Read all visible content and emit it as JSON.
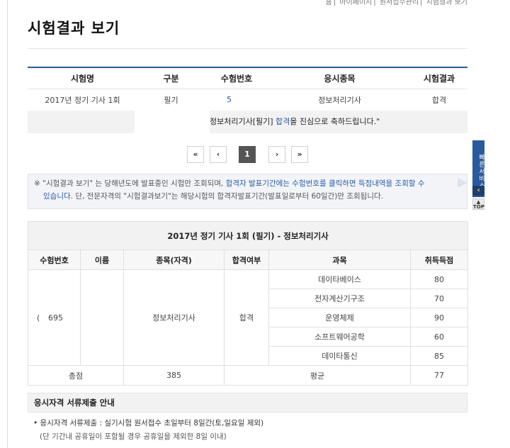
{
  "top_nav": [
    "홈",
    "마이페이지",
    "원서접수관리",
    "시험결과 보기"
  ],
  "page_title": "시험결과 보기",
  "result_table": {
    "headers": [
      "시험명",
      "구분",
      "수험번호",
      "응시종목",
      "시험결과"
    ],
    "row": {
      "exam_name": "2017년 정기 기사 1회",
      "type": "필기",
      "exam_number": "5",
      "subject": "정보처리기사",
      "result": "합격"
    }
  },
  "congrats": {
    "prefix": "정보처리기사[필기] ",
    "highlight": "합격",
    "suffix": "을 진심으로 축하드립니다.\""
  },
  "pagination": {
    "first": "«",
    "prev": "‹",
    "current": "1",
    "next": "›",
    "last": "»"
  },
  "notice": {
    "line1_a": "※ \"시험결과 보기\" 는 당해년도에 발표중인 시험만 조회되며, ",
    "line1_b": "합격자 발표기간에는 수험번호를 클릭하면 득점내역을 조회할 수",
    "line2_a": "있습니다.",
    "line2_b": " 단, 전문자격의 \"시험결과보기\"는 해당시험의 합격자발표기간(발표일로부터 60일간)만 조회됩니다."
  },
  "quick_service": {
    "label": "빠른서비스",
    "arrow": "‹",
    "top": "TOP"
  },
  "detail": {
    "caption": "2017년 정기 기사 1회 (필기) - 정보처리기사",
    "headers": [
      "수험번호",
      "이름",
      "종목(자격)",
      "합격여부",
      "과목",
      "취득득점"
    ],
    "exam_number": "695",
    "name": "",
    "qualification": "정보처리기사",
    "pass": "합격",
    "subjects": [
      {
        "name": "데이타베이스",
        "score": "80"
      },
      {
        "name": "전자계산기구조",
        "score": "70"
      },
      {
        "name": "운영체제",
        "score": "90"
      },
      {
        "name": "소프트웨어공학",
        "score": "60"
      },
      {
        "name": "데이타통신",
        "score": "85"
      }
    ],
    "total_label": "총점",
    "total": "385",
    "avg_label": "평균",
    "avg": "77"
  },
  "doc_submission": {
    "title": "응시자격 서류제출 안내",
    "line1": "• 응시자격 서류제출 : 실기시험 원서접수 초일부터 8일간(토,일요일 제외)",
    "line2": "(단 기간내 공휴일이 포함될 경우 공휴일을 제외한 8일 이내)"
  },
  "colors": {
    "accent": "#2a5a9c",
    "link": "#2a5aa8"
  }
}
